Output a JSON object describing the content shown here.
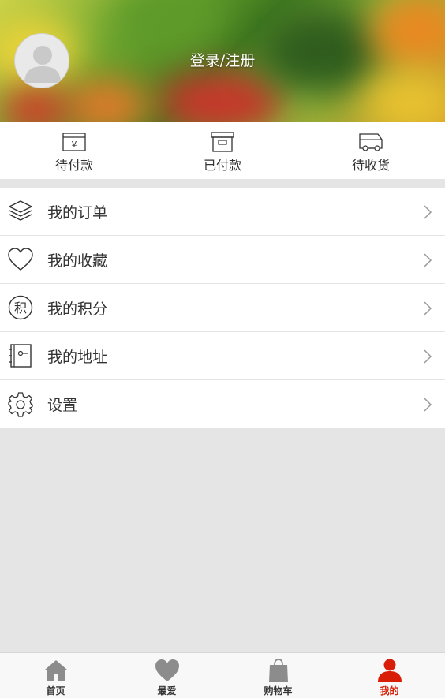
{
  "header": {
    "login_text": "登录/注册"
  },
  "status": [
    {
      "label": "待付款",
      "icon": "pending-payment-icon"
    },
    {
      "label": "已付款",
      "icon": "paid-box-icon"
    },
    {
      "label": "待收货",
      "icon": "delivery-truck-icon"
    }
  ],
  "menu": [
    {
      "label": "我的订单",
      "icon": "layers-icon"
    },
    {
      "label": "我的收藏",
      "icon": "heart-outline-icon"
    },
    {
      "label": "我的积分",
      "icon": "points-icon",
      "glyph": "积"
    },
    {
      "label": "我的地址",
      "icon": "address-book-icon"
    },
    {
      "label": "设置",
      "icon": "gear-icon"
    }
  ],
  "tabs": [
    {
      "label": "首页",
      "icon": "home-icon",
      "active": false
    },
    {
      "label": "最爱",
      "icon": "heart-icon",
      "active": false
    },
    {
      "label": "购物车",
      "icon": "shopping-bag-icon",
      "active": false
    },
    {
      "label": "我的",
      "icon": "user-icon",
      "active": true
    }
  ],
  "colors": {
    "active_tab": "#d81e06",
    "inactive_tab": "#8c8c8c",
    "background": "#e5e5e5"
  }
}
